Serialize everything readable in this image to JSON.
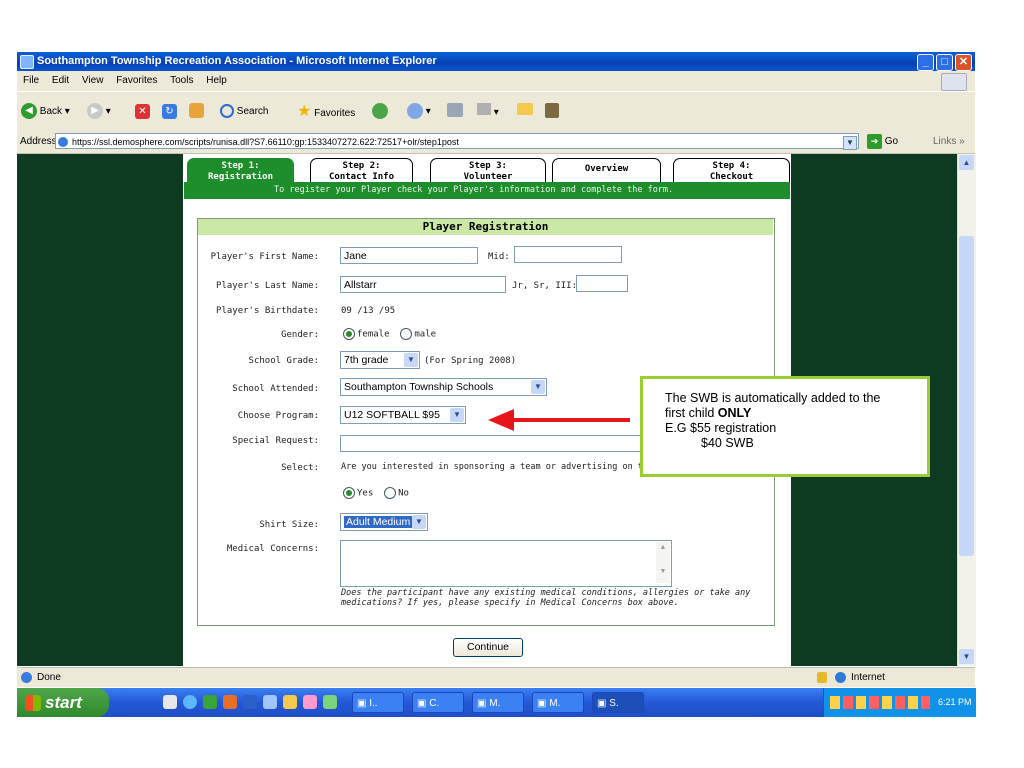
{
  "window": {
    "title": "Southampton Township Recreation Association - Microsoft Internet Explorer",
    "min": "_",
    "max": "□",
    "close": "✕"
  },
  "menu": [
    "File",
    "Edit",
    "View",
    "Favorites",
    "Tools",
    "Help"
  ],
  "toolbar": {
    "back": "Back",
    "search": "Search",
    "favorites": "Favorites"
  },
  "address": {
    "label": "Address",
    "url": "https://ssl.demosphere.com/scripts/runisa.dll?S7.66110:gp:1533407272.622:72517+olr/step1post",
    "go": "Go",
    "links": "Links"
  },
  "steps": [
    {
      "line1": "Step 1:",
      "line2": "Registration"
    },
    {
      "line1": "Step 2:",
      "line2": "Contact Info"
    },
    {
      "line1": "Step 3:",
      "line2": "Volunteer"
    },
    {
      "line1": "Overview",
      "line2": ""
    },
    {
      "line1": "Step 4:",
      "line2": "Checkout"
    }
  ],
  "banner": "To register your Player check your Player's information and complete the form.",
  "form": {
    "heading": "Player Registration",
    "first_name_label": "Player's First Name:",
    "first_name": "Jane",
    "mid_label": "Mid:",
    "last_name_label": "Player's Last Name:",
    "last_name": "Allstarr",
    "suffix_label": "Jr, Sr, III:",
    "birthdate_label": "Player's Birthdate:",
    "birthdate": "09 /13 /95",
    "gender_label": "Gender:",
    "gender_female": "female",
    "gender_male": "male",
    "grade_label": "School Grade:",
    "grade": "7th grade",
    "grade_note": "(For Spring 2008)",
    "school_label": "School Attended:",
    "school": "Southampton Township Schools",
    "program_label": "Choose Program:",
    "program": "U12 SOFTBALL $95",
    "special_label": "Special Request:",
    "select_label": "Select:",
    "sponsor_question": "Are you interested in sponsoring a team or advertising on the STRA Homepage?",
    "yes": "Yes",
    "no": "No",
    "shirt_label": "Shirt Size:",
    "shirt": "Adult Medium",
    "medical_label": "Medical Concerns:",
    "medical_note": "Does the participant have any existing medical conditions, allergies or take any medications? If yes, please specify in Medical Concerns box above.",
    "continue": "Continue"
  },
  "annotation": {
    "line1": "The SWB is automatically added to the",
    "line2a": "first child ",
    "line2b": "ONLY",
    "line3": "E.G $55 registration",
    "line4": "$40  SWB",
    "border_color": "#9acd32",
    "arrow_color": "#e8141b"
  },
  "status": {
    "left": "Done",
    "zone": "Internet"
  },
  "taskbar": {
    "start": "start",
    "tasks": [
      "I..",
      "C.",
      "M.",
      "M.",
      "S."
    ],
    "time": "6:21 PM"
  }
}
